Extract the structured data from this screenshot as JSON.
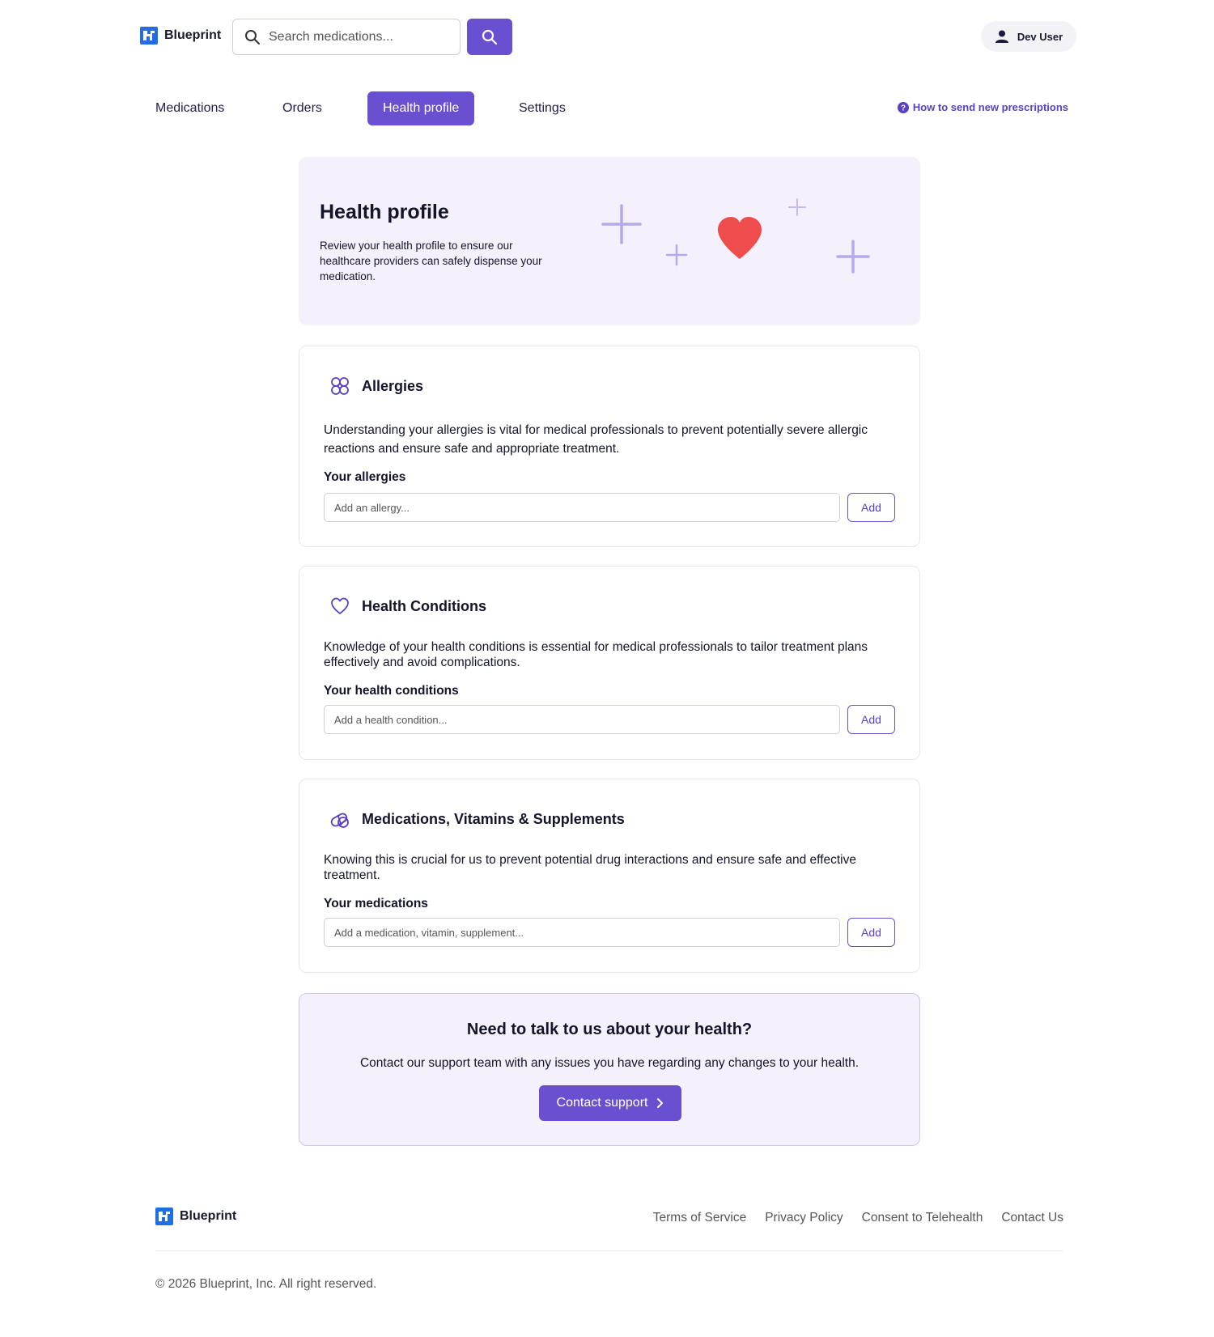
{
  "brand": {
    "name": "Blueprint",
    "color": "#1f6fe0",
    "accent": "#6b4fd1"
  },
  "header": {
    "search_placeholder": "Search medications...",
    "user_name": "Dev User"
  },
  "nav": {
    "tabs": [
      {
        "label": "Medications",
        "active": false
      },
      {
        "label": "Orders",
        "active": false
      },
      {
        "label": "Health profile",
        "active": true
      },
      {
        "label": "Settings",
        "active": false
      }
    ],
    "help_link": "How to send new prescriptions"
  },
  "hero": {
    "title": "Health profile",
    "description": "Review your health profile to ensure our healthcare providers can safely dispense your medication."
  },
  "sections": {
    "allergies": {
      "title": "Allergies",
      "description": "Understanding your allergies is vital for medical professionals to prevent potentially severe allergic reactions and ensure safe and appropriate treatment.",
      "label": "Your allergies",
      "placeholder": "Add an allergy...",
      "add_label": "Add"
    },
    "conditions": {
      "title": "Health Conditions",
      "description": "Knowledge of your health conditions is essential for medical professionals to tailor treatment plans effectively and avoid complications.",
      "label": "Your health conditions",
      "placeholder": "Add a health condition...",
      "add_label": "Add"
    },
    "medications": {
      "title": "Medications, Vitamins & Supplements",
      "description": "Knowing this is crucial for us to prevent potential drug interactions and ensure safe and effective treatment.",
      "label": "Your medications",
      "placeholder": "Add a medication, vitamin, supplement...",
      "add_label": "Add"
    }
  },
  "support": {
    "title": "Need to talk to us about your health?",
    "description": "Contact our support team with any issues you have regarding any changes to your health.",
    "button_label": "Contact support"
  },
  "footer": {
    "links": [
      "Terms of Service",
      "Privacy Policy",
      "Consent to Telehealth",
      "Contact Us"
    ],
    "copyright": "© 2026 Blueprint, Inc. All right reserved."
  }
}
